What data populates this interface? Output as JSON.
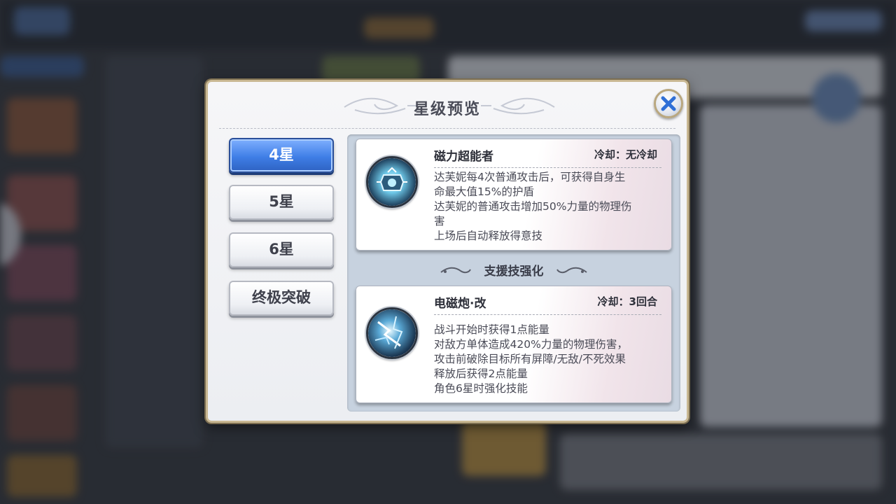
{
  "dialog": {
    "title": "星级预览"
  },
  "tabs": [
    {
      "label": "4星",
      "active": true
    },
    {
      "label": "5星",
      "active": false
    },
    {
      "label": "6星",
      "active": false
    },
    {
      "label": "终极突破",
      "active": false
    }
  ],
  "skills": {
    "passive": {
      "name": "磁力超能者",
      "cooldown": "冷却：无冷却",
      "icon": "magnet-shield-icon",
      "lines": [
        "达芙妮每4次普通攻击后，可获得自身生",
        "命最大值15%的护盾",
        "达芙妮的普通攻击增加50%力量的物理伤",
        "害",
        "上场后自动释放得意技"
      ]
    },
    "support_heading": "支援技强化",
    "support": {
      "name": "电磁炮·改",
      "cooldown": "冷却：3回合",
      "icon": "lightning-railgun-icon",
      "lines": [
        "战斗开始时获得1点能量",
        "对敌方单体造成420%力量的物理伤害，",
        "攻击前破除目标所有屏障/无敌/不死效果",
        "释放后获得2点能量",
        "角色6星时强化技能"
      ]
    }
  },
  "colors": {
    "active_tab": "#3f7ee6",
    "frame_gold": "#c9b893",
    "close_blue": "#2f6fd6"
  }
}
